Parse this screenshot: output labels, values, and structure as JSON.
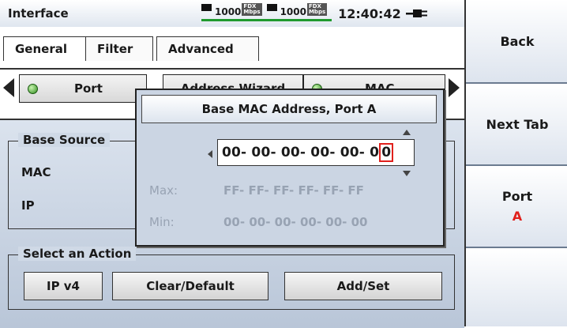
{
  "header": {
    "title": "Interface",
    "links": [
      {
        "speed": "1000",
        "badge": "FDX\nMbps"
      },
      {
        "speed": "1000",
        "badge": "FDX\nMbps"
      }
    ],
    "clock": "12:40:42"
  },
  "tabs": [
    {
      "label": "General"
    },
    {
      "label": "Filter"
    },
    {
      "label": "Advanced"
    }
  ],
  "subtabs": {
    "port_label": "Port",
    "wizard_label": "Address Wizard",
    "mac_label": "MAC"
  },
  "main": {
    "base_group_label": "Base Source",
    "mac_label": "MAC",
    "ip_label": "IP",
    "action_group_label": "Select an Action",
    "actions": {
      "ipv4": "IP v4",
      "clear_default": "Clear/Default",
      "add_set": "Add/Set"
    }
  },
  "side": {
    "back": "Back",
    "next_tab": "Next Tab",
    "port": "Port",
    "port_value": "A"
  },
  "dialog": {
    "title": "Base MAC Address, Port A",
    "mac_prefix": "00- 00- 00- 00- 00- 0",
    "mac_last": "0",
    "max_label": "Max:",
    "max_value": "FF- FF- FF- FF- FF- FF",
    "min_label": "Min:",
    "min_value": "00- 00- 00- 00- 00- 00"
  },
  "colors": {
    "accent_red": "#e0201c",
    "link_green": "#1f9a2e",
    "panel_blue": "#cbd5e3"
  }
}
